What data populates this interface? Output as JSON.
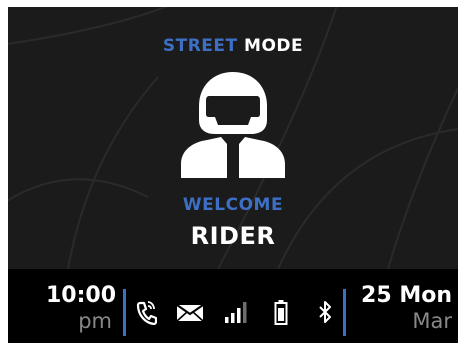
{
  "mode": {
    "accent_word": "STREET",
    "main_word": "MODE"
  },
  "greeting": {
    "line1": "WELCOME",
    "line2": "RIDER"
  },
  "clock": {
    "time": "10:00",
    "ampm": "pm"
  },
  "date": {
    "day": "25 Mon",
    "month": "Mar"
  },
  "status_icons": [
    "phone-call-icon",
    "mail-icon",
    "signal-icon",
    "battery-icon",
    "bluetooth-icon"
  ],
  "colors": {
    "accent": "#3d6fc4",
    "background": "#1b1b1b",
    "status_bar": "#000000",
    "text": "#ffffff",
    "muted_text": "#888888"
  }
}
